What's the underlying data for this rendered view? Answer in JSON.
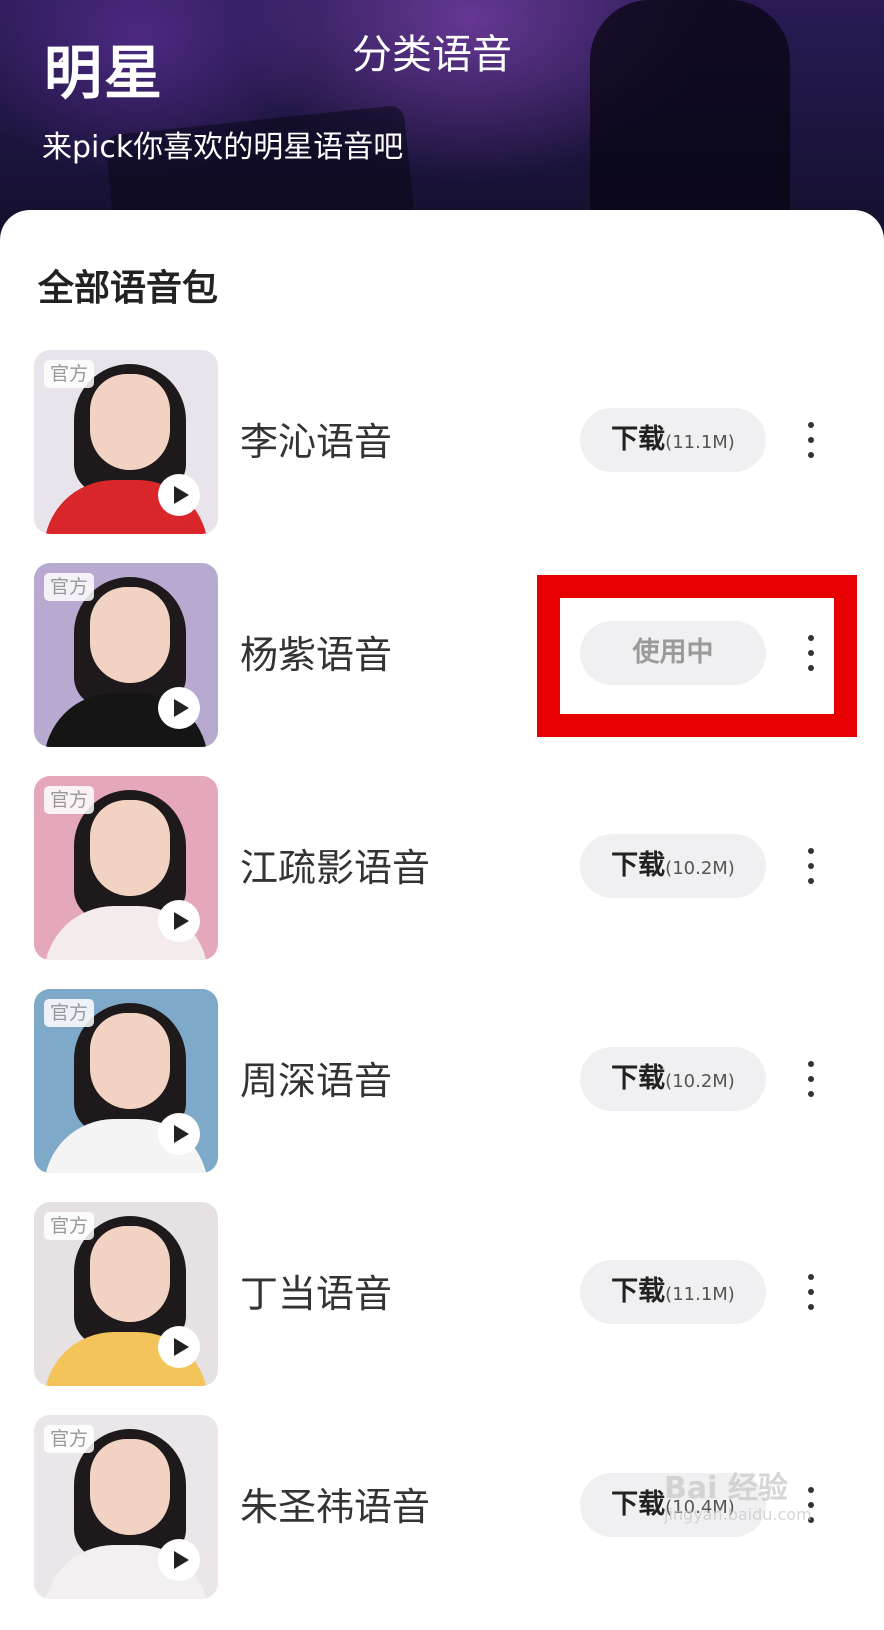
{
  "header": {
    "back_glyph": "‹",
    "title": "明星",
    "tab_label": "分类语音",
    "subtitle": "来pick你喜欢的明星语音吧"
  },
  "section": {
    "title": "全部语音包"
  },
  "voice_packs": [
    {
      "badge": "官方",
      "name": "李沁语音",
      "action": "下载",
      "size": "(11.1M)",
      "status": "download",
      "colors": {
        "bg": "#e9e4ec",
        "body": "#d8262b"
      }
    },
    {
      "badge": "官方",
      "name": "杨紫语音",
      "action": "使用中",
      "size": "",
      "status": "in_use",
      "colors": {
        "bg": "#b7a9d0",
        "body": "#151515"
      }
    },
    {
      "badge": "官方",
      "name": "江疏影语音",
      "action": "下载",
      "size": "(10.2M)",
      "status": "download",
      "colors": {
        "bg": "#e5a8bb",
        "body": "#f4ecec"
      }
    },
    {
      "badge": "官方",
      "name": "周深语音",
      "action": "下载",
      "size": "(10.2M)",
      "status": "download",
      "colors": {
        "bg": "#7fa9c8",
        "body": "#f4f4f4"
      }
    },
    {
      "badge": "官方",
      "name": "丁当语音",
      "action": "下载",
      "size": "(11.1M)",
      "status": "download",
      "colors": {
        "bg": "#e6e2e4",
        "body": "#f2c45a"
      }
    },
    {
      "badge": "官方",
      "name": "朱圣祎语音",
      "action": "下载",
      "size": "(10.4M)",
      "status": "download",
      "colors": {
        "bg": "#eae6ea",
        "body": "#f3f0f2"
      }
    }
  ],
  "watermark": {
    "text": "Bai 经验",
    "sub": "jingyan.baidu.com"
  },
  "colors": {
    "highlight_border": "#e60000",
    "button_bg": "#f0f0f3",
    "hero_dark": "#1c143d"
  }
}
